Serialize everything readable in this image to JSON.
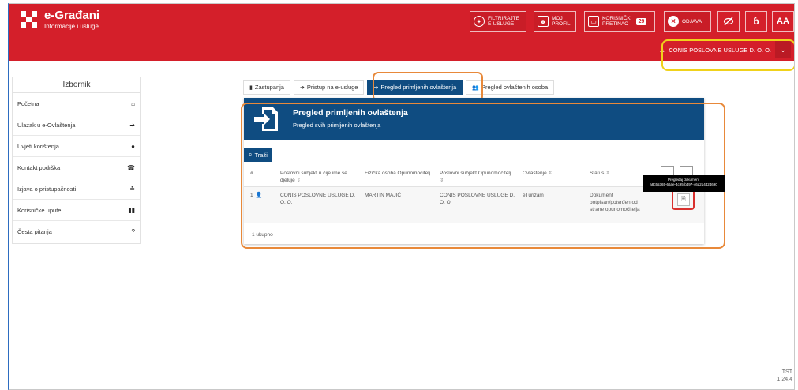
{
  "app": {
    "title": "e-Građani",
    "subtitle": "Informacije i usluge",
    "brand_color": "#d41f2a",
    "primary_color": "#0f4c81"
  },
  "header": {
    "filter_label_1": "FILTRIRAJTE",
    "filter_label_2": "E-USLUGE",
    "profile_label_1": "MOJ",
    "profile_label_2": "PROFIL",
    "inbox_label_1": "KORISNIČKI",
    "inbox_label_2": "PRETINAC",
    "inbox_count": "29",
    "logout_label": "ODJAVA",
    "dyslexic_label": "ɓ",
    "font_size_label": "AA"
  },
  "user": {
    "name": "CONIS POSLOVNE USLUGE D. O. O."
  },
  "sidebar": {
    "title": "Izbornik",
    "items": [
      {
        "label": "Početna",
        "icon": "home-icon",
        "glyph": "🏠"
      },
      {
        "label": "Ulazak u e-Ovlaštenja",
        "icon": "sign-in-icon",
        "glyph": "➜"
      },
      {
        "label": "Uvjeti korištenja",
        "icon": "info-icon",
        "glyph": "ℹ"
      },
      {
        "label": "Kontakt podrška",
        "icon": "phone-icon",
        "glyph": "☎"
      },
      {
        "label": "Izjava o pristupačnosti",
        "icon": "accessibility-icon",
        "glyph": "≟"
      },
      {
        "label": "Korisničke upute",
        "icon": "book-icon",
        "glyph": "▮▮"
      },
      {
        "label": "Česta pitanja",
        "icon": "question-icon",
        "glyph": "?"
      }
    ]
  },
  "tabs": [
    {
      "label": "Zastupanja",
      "icon": "document-icon"
    },
    {
      "label": "Pristup na e-usluge",
      "icon": "sign-in-icon"
    },
    {
      "label": "Pregled primljenih ovlaštenja",
      "icon": "document-arrow-icon",
      "active": true
    },
    {
      "label": "Pregled ovlaštenih osoba",
      "icon": "users-icon"
    }
  ],
  "panel": {
    "title": "Pregled primljenih ovlaštenja",
    "subtitle": "Pregled svih primljenih ovlaštenja",
    "search_label": "Traži",
    "columns": [
      "#",
      "Poslovni subjekt u čije ime se djeluje",
      "Fizička osoba Opunomoćitelj",
      "Poslovni subjekt Opunomoćitelj",
      "Ovlaštenje",
      "Status"
    ],
    "rows": [
      {
        "num": "1",
        "subject": "CONIS POSLOVNE USLUGE D. O. O.",
        "person": "MARTIN MAJIĆ",
        "grantor_subject": "CONIS POSLOVNE USLUGE D. O. O.",
        "authorization": "eTurizam",
        "status": "Dokument potpisan/potvrđen od strane opunomoćitelja"
      }
    ],
    "tooltip_line1": "Pregledaj dokument",
    "tooltip_line2": "a8c55365-66ae-4c95-b497-46a214424690",
    "footer": "1 ukupno"
  },
  "version": {
    "line1": "TST",
    "line2": "1.24.4"
  }
}
